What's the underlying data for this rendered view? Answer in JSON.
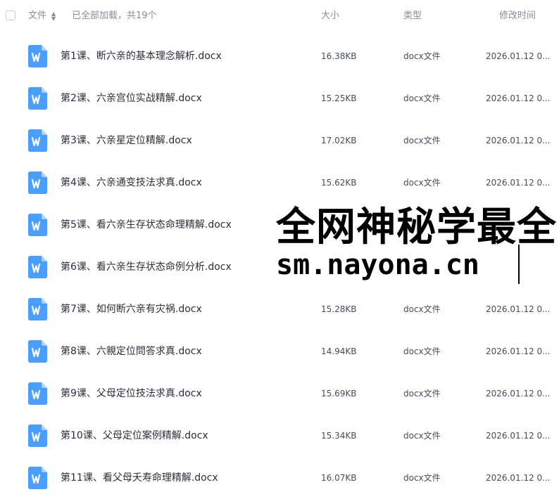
{
  "header": {
    "name_label": "文件",
    "loaded_text": "已全部加载，共19个",
    "size_label": "大小",
    "type_label": "类型",
    "time_label": "修改时间"
  },
  "files": [
    {
      "icon": "word-doc-icon",
      "name": "第1课、断六亲的基本理念解析.docx",
      "size": "16.38KB",
      "type": "docx文件",
      "time": "2026.01.12 0..."
    },
    {
      "icon": "word-doc-icon",
      "name": "第2课、六亲宫位实战精解.docx",
      "size": "15.25KB",
      "type": "docx文件",
      "time": "2026.01.12 0..."
    },
    {
      "icon": "word-doc-icon",
      "name": "第3课、六亲星定位精解.docx",
      "size": "17.02KB",
      "type": "docx文件",
      "time": "2026.01.12 0..."
    },
    {
      "icon": "word-doc-icon",
      "name": "第4课、六亲通变技法求真.docx",
      "size": "15.62KB",
      "type": "docx文件",
      "time": "2026.01.12 0..."
    },
    {
      "icon": "word-doc-icon",
      "name": "第5课、看六亲生存状态命理精解.docx",
      "size": "",
      "type": "",
      "time": ""
    },
    {
      "icon": "word-doc-icon",
      "name": "第6课、看六亲生存状态命例分析.docx",
      "size": "",
      "type": "",
      "time": ""
    },
    {
      "icon": "word-doc-icon",
      "name": "第7课、如何断六亲有灾祸.docx",
      "size": "15.28KB",
      "type": "docx文件",
      "time": "2026.01.12 0..."
    },
    {
      "icon": "word-doc-icon",
      "name": "第8课、六親定位問答求真.docx",
      "size": "14.94KB",
      "type": "docx文件",
      "time": "2026.01.12 0..."
    },
    {
      "icon": "word-doc-icon",
      "name": "第9课、父母定位技法求真.docx",
      "size": "15.69KB",
      "type": "docx文件",
      "time": "2026.01.12 0..."
    },
    {
      "icon": "word-doc-icon",
      "name": "第10课、父母定位案例精解.docx",
      "size": "15.34KB",
      "type": "docx文件",
      "time": "2026.01.12 0..."
    },
    {
      "icon": "word-doc-icon",
      "name": "第11课、看父母夭寿命理精解.docx",
      "size": "16.07KB",
      "type": "docx文件",
      "time": "2026.01.12 0..."
    }
  ],
  "watermark": {
    "line1": "全网神秘学最全",
    "line2": "sm.nayona.cn"
  },
  "colors": {
    "icon_blue": "#4a9eff",
    "icon_light": "#a9d3ff",
    "header_text": "#878c9c",
    "row_text": "#2b2f36"
  }
}
